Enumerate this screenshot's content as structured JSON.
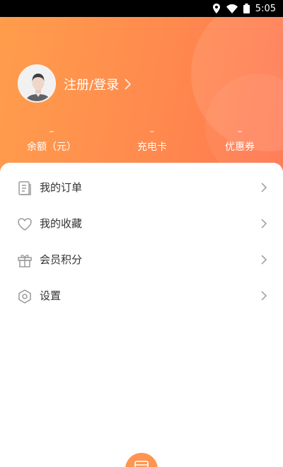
{
  "status_bar": {
    "time": "5:05",
    "icons": [
      "location-icon",
      "wifi-icon",
      "battery-icon"
    ]
  },
  "header": {
    "login_label": "注册/登录",
    "stats": [
      {
        "value": "–",
        "label": "余额（元）"
      },
      {
        "value": "–",
        "label": "充电卡"
      },
      {
        "value": "–",
        "label": "优惠券"
      }
    ]
  },
  "menu": [
    {
      "label": "我的订单",
      "icon": "order-list-icon"
    },
    {
      "label": "我的收藏",
      "icon": "heart-icon"
    },
    {
      "label": "会员积分",
      "icon": "gift-icon"
    },
    {
      "label": "设置",
      "icon": "settings-hexagon-icon"
    }
  ],
  "colors": {
    "accent_start": "#ff9d4c",
    "accent_end": "#ff7650",
    "text": "#333333",
    "muted": "#9a9a9a"
  }
}
